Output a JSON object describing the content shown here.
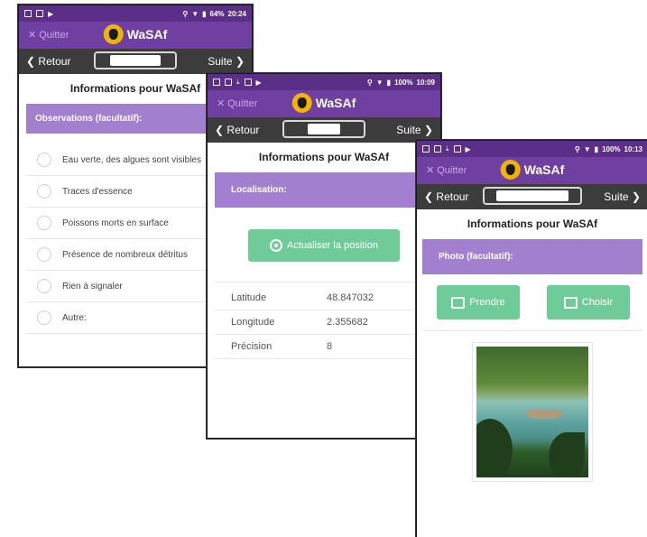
{
  "status": {
    "screen1": {
      "battery": "64%",
      "time": "20:24"
    },
    "screen2": {
      "battery": "100%",
      "time": "10:09"
    },
    "screen3": {
      "battery": "100%",
      "time": "10:13"
    }
  },
  "app": {
    "quit_label": "Quitter",
    "name": "WaSAf",
    "back_label": "Retour",
    "next_label": "Suite",
    "page_title": "Informations pour WaSAf"
  },
  "screen1": {
    "section": "Observations (facultatif):",
    "options": [
      "Eau verte, des algues sont visibles",
      "Traces d'essence",
      "Poissons morts en surface",
      "Présence de nombreux détritus",
      "Rien à signaler",
      "Autre:"
    ]
  },
  "screen2": {
    "section": "Localisation:",
    "update_button": "Actualiser la position",
    "rows": [
      {
        "label": "Latitude",
        "value": "48.847032"
      },
      {
        "label": "Longitude",
        "value": "2.355682"
      },
      {
        "label": "Précision",
        "value": "8"
      }
    ]
  },
  "screen3": {
    "section": "Photo (facultatif):",
    "take_button": "Prendre",
    "choose_button": "Choisir"
  },
  "colors": {
    "status_bar": "#5b2f87",
    "app_bar": "#6f3fa2",
    "nav_bar": "#3c3c3c",
    "section_header": "#a27fcf",
    "button": "#6fcb98"
  },
  "icons": [
    "close-icon",
    "logo-icon",
    "chevron-left-icon",
    "chevron-right-icon",
    "target-icon",
    "camera-icon",
    "image-icon"
  ]
}
